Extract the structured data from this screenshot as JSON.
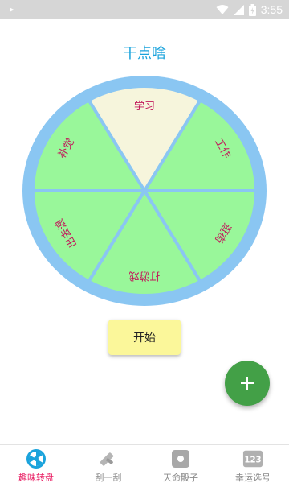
{
  "status_bar": {
    "time": "3:55"
  },
  "title": "干点啥",
  "wheel": {
    "segments": [
      {
        "label": "学习",
        "color": "#f6f5dc"
      },
      {
        "label": "工作",
        "color": "#99f79a"
      },
      {
        "label": "逛街",
        "color": "#99f79a"
      },
      {
        "label": "打游戏",
        "color": "#99f79a"
      },
      {
        "label": "出去浪",
        "color": "#99f79a"
      },
      {
        "label": "补觉",
        "color": "#99f79a"
      }
    ],
    "rim_color": "#8ac6f2",
    "label_color": "#c2185b"
  },
  "start_button": {
    "label": "开始"
  },
  "fab": {
    "icon": "plus-icon"
  },
  "bottom_nav": {
    "items": [
      {
        "label": "趣味转盘",
        "icon": "wheel-icon",
        "active": true
      },
      {
        "label": "刮一刮",
        "icon": "scratch-icon",
        "active": false
      },
      {
        "label": "天命骰子",
        "icon": "dice-icon",
        "active": false
      },
      {
        "label": "幸运选号",
        "icon": "number-icon",
        "active": false
      }
    ]
  },
  "colors": {
    "accent": "#1aa3dc",
    "active_nav": "#e91e63",
    "fab": "#43a047",
    "button": "#fbf79a"
  }
}
